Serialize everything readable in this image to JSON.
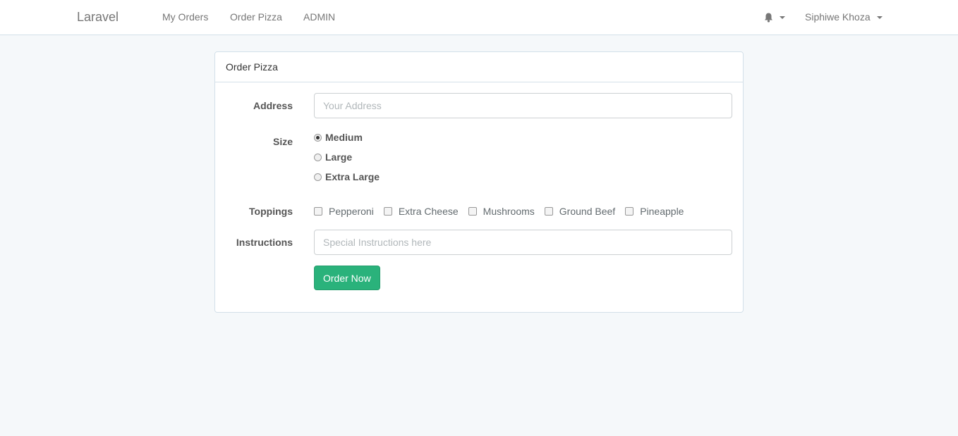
{
  "navbar": {
    "brand": "Laravel",
    "links": [
      "My Orders",
      "Order Pizza",
      "ADMIN"
    ],
    "notification_icon": "bell-icon",
    "user_name": "Siphiwe Khoza"
  },
  "panel": {
    "heading": "Order Pizza",
    "address": {
      "label": "Address",
      "placeholder": "Your Address",
      "value": ""
    },
    "size": {
      "label": "Size",
      "options": [
        "Medium",
        "Large",
        "Extra Large"
      ],
      "selected": "Medium"
    },
    "toppings": {
      "label": "Toppings",
      "options": [
        "Pepperoni",
        "Extra Cheese",
        "Mushrooms",
        "Ground Beef",
        "Pineapple"
      ]
    },
    "instructions": {
      "label": "Instructions",
      "placeholder": "Special Instructions here",
      "value": ""
    },
    "submit_label": "Order Now"
  },
  "colors": {
    "background": "#f5f8fa",
    "button": "#2ab27b",
    "border": "#d3e0e9"
  }
}
